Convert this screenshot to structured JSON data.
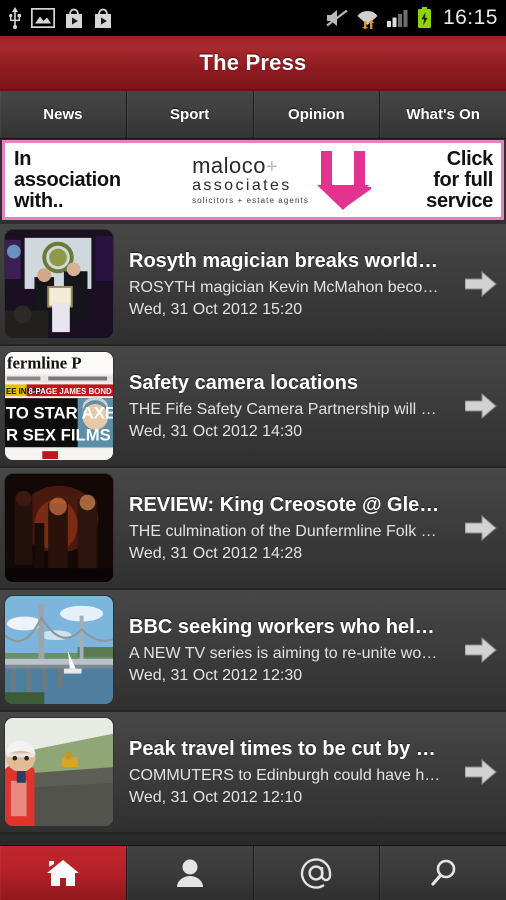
{
  "statusbar": {
    "time": "16:15",
    "left_icons": [
      "usb-icon",
      "screenshot-image-icon",
      "play-store-icon",
      "play-store-icon"
    ],
    "right_icons": [
      "mute-icon",
      "wifi-icon",
      "signal-icon",
      "battery-charging-icon"
    ]
  },
  "header": {
    "title": "The Press"
  },
  "tabs": [
    {
      "label": "News",
      "active": true
    },
    {
      "label": "Sport",
      "active": false
    },
    {
      "label": "Opinion",
      "active": false
    },
    {
      "label": "What's On",
      "active": false
    }
  ],
  "ad": {
    "left_line1": "In",
    "left_line2": "association",
    "left_line3": "with..",
    "brand_line1": "maloco",
    "brand_plus": "+",
    "brand_line2": "associates",
    "brand_line3": "solicitors + estate agents",
    "right_line1": "Click",
    "right_line2": "for full",
    "right_line3": "service",
    "border_color": "#e87fc0",
    "logo_color": "#e2338e"
  },
  "articles": [
    {
      "title": "Rosyth magician breaks world…",
      "description": "ROSYTH magician Kevin McMahon beco…",
      "date": "Wed, 31 Oct 2012 15:20",
      "thumb": "award-ceremony-photo"
    },
    {
      "title": "Safety camera locations",
      "description": "THE Fife Safety Camera Partnership will …",
      "date": "Wed, 31 Oct 2012 14:30",
      "thumb": "newspaper-front-page-photo"
    },
    {
      "title": "REVIEW: King Creosote @ Gle…",
      "description": "THE culmination of the Dunfermline Folk …",
      "date": "Wed, 31 Oct 2012 14:28",
      "thumb": "concert-stage-photo"
    },
    {
      "title": "BBC seeking workers who hel…",
      "description": "A NEW TV series is aiming to re-unite wo…",
      "date": "Wed, 31 Oct 2012 12:30",
      "thumb": "forth-road-bridge-photo"
    },
    {
      "title": "Peak travel times to be cut by …",
      "description": "COMMUTERS to Edinburgh could have h…",
      "date": "Wed, 31 Oct 2012 12:10",
      "thumb": "construction-worker-photo"
    }
  ],
  "bottomnav": [
    {
      "icon": "home-icon",
      "active": true
    },
    {
      "icon": "person-icon",
      "active": false
    },
    {
      "icon": "at-sign-icon",
      "active": false
    },
    {
      "icon": "search-icon",
      "active": false
    }
  ]
}
